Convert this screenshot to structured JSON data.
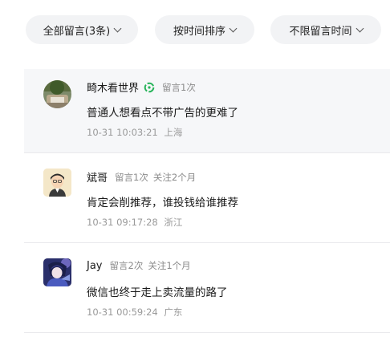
{
  "filters": {
    "all_comments": "全部留言(3条)",
    "sort_by_time": "按时间排序",
    "time_range": "不限留言时间"
  },
  "comments": [
    {
      "username": "畸木看世界",
      "verified_icon": "green-ring-icon",
      "tags": [
        "留言1次"
      ],
      "text": "普通人想看点不带广告的更难了",
      "date": "10-31 10:03:21",
      "location": "上海",
      "highlighted": true
    },
    {
      "username": "斌哥",
      "tags": [
        "留言1次",
        "关注2个月"
      ],
      "text": "肯定会削推荐，谁投钱给谁推荐",
      "date": "10-31 09:17:28",
      "location": "浙江"
    },
    {
      "username": "Jay",
      "tags": [
        "留言2次",
        "关注1个月"
      ],
      "text": "微信也终于走上卖流量的路了",
      "date": "10-31 00:59:24",
      "location": "广东"
    }
  ],
  "colors": {
    "pill_bg": "#f2f3f5",
    "highlight_bg": "#f6f7f9",
    "badge_green": "#27b45a",
    "meta_gray": "#8a8a8a"
  }
}
